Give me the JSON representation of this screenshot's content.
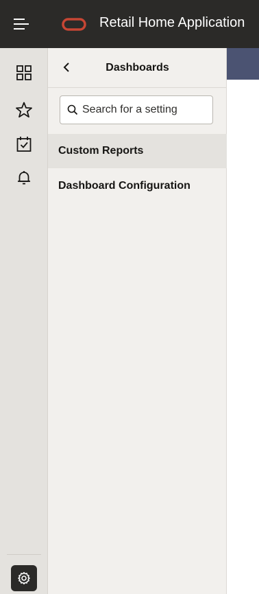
{
  "header": {
    "app_title": "Retail Home Application",
    "menu_icon": "hamburger-icon",
    "logo": "oracle-logo",
    "brand_color": "#c74634"
  },
  "rail": {
    "items": [
      {
        "icon": "dashboard-grid-icon"
      },
      {
        "icon": "star-icon"
      },
      {
        "icon": "calendar-check-icon"
      },
      {
        "icon": "bell-icon"
      }
    ],
    "settings_icon": "gear-icon"
  },
  "panel": {
    "title": "Dashboards",
    "back_icon": "chevron-left-icon",
    "search": {
      "placeholder": "Search for a setting",
      "value": ""
    },
    "items": [
      {
        "label": "Custom Reports",
        "selected": true
      },
      {
        "label": "Dashboard Configuration",
        "selected": false
      }
    ]
  },
  "colors": {
    "topbar": "#2b2a28",
    "rail": "#e4e2de",
    "panel": "#f2f0ed",
    "accent": "#4b5372"
  }
}
